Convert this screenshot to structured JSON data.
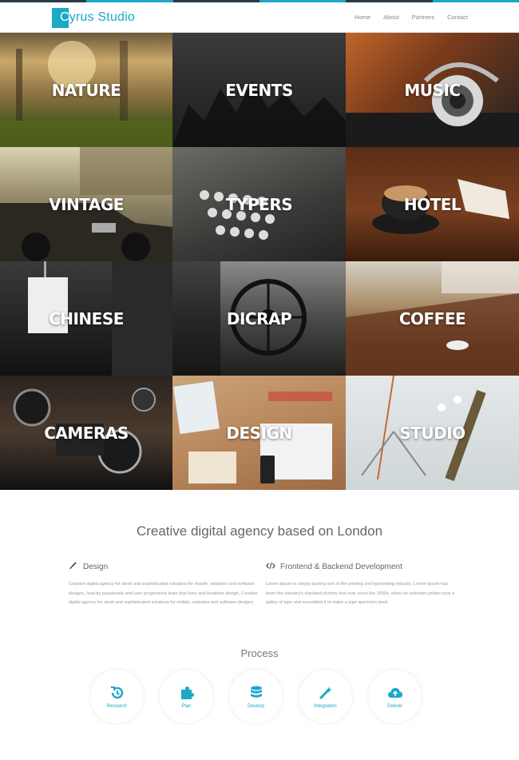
{
  "brand": {
    "name_first": "C",
    "name_rest": "yrus Studio",
    "accent": "#1aa9c7"
  },
  "nav": [
    "Home",
    "About",
    "Partners",
    "Contact"
  ],
  "tiles": [
    {
      "label": "NATURE"
    },
    {
      "label": "EVENTS"
    },
    {
      "label": "MUSIC"
    },
    {
      "label": "VINTAGE"
    },
    {
      "label": "TYPERS"
    },
    {
      "label": "HOTEL"
    },
    {
      "label": "CHINESE"
    },
    {
      "label": "DICRAP"
    },
    {
      "label": "COFFEE"
    },
    {
      "label": "CAMERAS"
    },
    {
      "label": "DESIGN"
    },
    {
      "label": "STUDIO"
    }
  ],
  "headline": "Creative digital agency based on London",
  "features": [
    {
      "icon": "brush-icon",
      "title": "Design",
      "body": "Creative digital agency for sleek and sophisticated solutions for mobile, websites and software designs, lead by passionate and user progressive team that lives and breathes design. Creative digital agency for sleek and sophisticated solutions for mobile, websites and software designs."
    },
    {
      "icon": "code-icon",
      "title": "Frontend & Backend Development",
      "body": "Lorem Ipsum is simply dummy text of the printing and typesetting industry. Lorem Ipsum has been the industry's standard dummy text ever since the 1500s, when an unknown printer took a galley of type and scrambled it to make a type specimen book."
    }
  ],
  "process": {
    "title": "Process",
    "steps": [
      {
        "label": "Research",
        "icon": "history-icon"
      },
      {
        "label": "Plan",
        "icon": "puzzle-icon"
      },
      {
        "label": "Deveop",
        "icon": "database-icon"
      },
      {
        "label": "Integration",
        "icon": "magic-wand-icon"
      },
      {
        "label": "Deliver",
        "icon": "cloud-upload-icon"
      }
    ]
  }
}
